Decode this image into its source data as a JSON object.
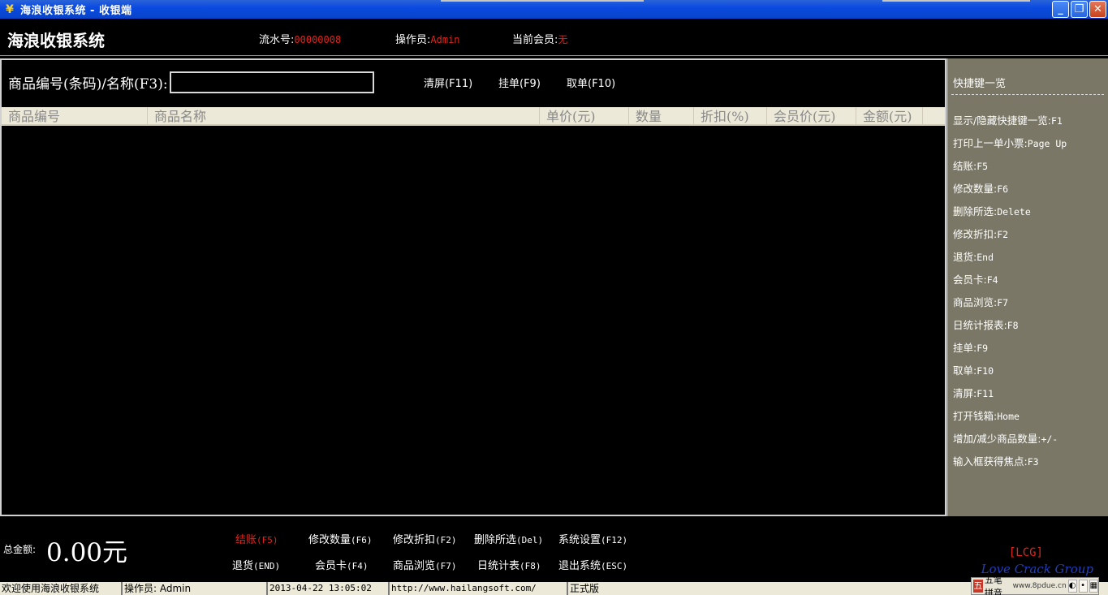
{
  "window": {
    "title": "海浪收银系统 - 收银端",
    "app_icon": "¥",
    "controls": {
      "minimize": "_",
      "maximize": "❐",
      "close": "✕"
    }
  },
  "header": {
    "brand": "海浪收银系统",
    "serial_label": "流水号:",
    "serial_value": "00000008",
    "operator_label": "操作员:",
    "operator_value": "Admin",
    "member_label": "当前会员:",
    "member_value": "无"
  },
  "search": {
    "label": "商品编号(条码)/名称(F3):",
    "value": "",
    "placeholder": ""
  },
  "actions": {
    "clear": "清屏(F11)",
    "hold": "挂单(F9)",
    "retrieve": "取单(F10)"
  },
  "grid": {
    "columns": [
      "商品编号",
      "商品名称",
      "单价(元)",
      "数量",
      "折扣(%)",
      "会员价(元)",
      "金额(元)"
    ],
    "rows": []
  },
  "shortcuts": {
    "title": "快捷键一览",
    "items": [
      {
        "label": "显示/隐藏快捷键一览:",
        "key": "F1"
      },
      {
        "label": "打印上一单小票:",
        "key": "Page Up"
      },
      {
        "label": "结账:",
        "key": "F5"
      },
      {
        "label": "修改数量:",
        "key": "F6"
      },
      {
        "label": "删除所选:",
        "key": "Delete"
      },
      {
        "label": "修改折扣:",
        "key": "F2"
      },
      {
        "label": "退货:",
        "key": "End"
      },
      {
        "label": "会员卡:",
        "key": "F4"
      },
      {
        "label": "商品浏览:",
        "key": "F7"
      },
      {
        "label": "日统计报表:",
        "key": "F8"
      },
      {
        "label": "挂单:",
        "key": "F9"
      },
      {
        "label": "取单:",
        "key": "F10"
      },
      {
        "label": "清屏:",
        "key": "F11"
      },
      {
        "label": "打开钱箱:",
        "key": "Home"
      },
      {
        "label": "增加/减少商品数量:",
        "key": "+/-"
      },
      {
        "label": "输入框获得焦点:",
        "key": "F3"
      }
    ]
  },
  "bottom": {
    "total_label": "总金额:",
    "total_value": "0.00元",
    "buttons": {
      "checkout": {
        "label": "结账",
        "key": "(F5)"
      },
      "modify_qty": {
        "label": "修改数量",
        "key": "(F6)"
      },
      "modify_discount": {
        "label": "修改折扣",
        "key": "(F2)"
      },
      "delete_selected": {
        "label": "删除所选",
        "key": "(Del)"
      },
      "settings": {
        "label": "系统设置",
        "key": "(F12)"
      },
      "return": {
        "label": "退货",
        "key": "(END)"
      },
      "member_card": {
        "label": "会员卡",
        "key": "(F4)"
      },
      "browse": {
        "label": "商品浏览",
        "key": "(F7)"
      },
      "daily_report": {
        "label": "日统计表",
        "key": "(F8)"
      },
      "exit": {
        "label": "退出系统",
        "key": "(ESC)"
      }
    },
    "watermark1": "[LCG]",
    "watermark2": "Love Crack Group"
  },
  "statusbar": {
    "welcome": "欢迎使用海浪收银系统",
    "operator": "操作员: Admin",
    "datetime": "2013-04-22 13:05:02",
    "url": "http://www.hailangsoft.com/",
    "edition": "正式版"
  },
  "ime": {
    "name": "五笔拼音",
    "extra": "www.8pdue.cn"
  },
  "colors": {
    "title_bar": "#0a4ae0",
    "highlight_red": "#e0261d",
    "side_panel": "#7a7766",
    "grid_header": "#ece9d8"
  }
}
